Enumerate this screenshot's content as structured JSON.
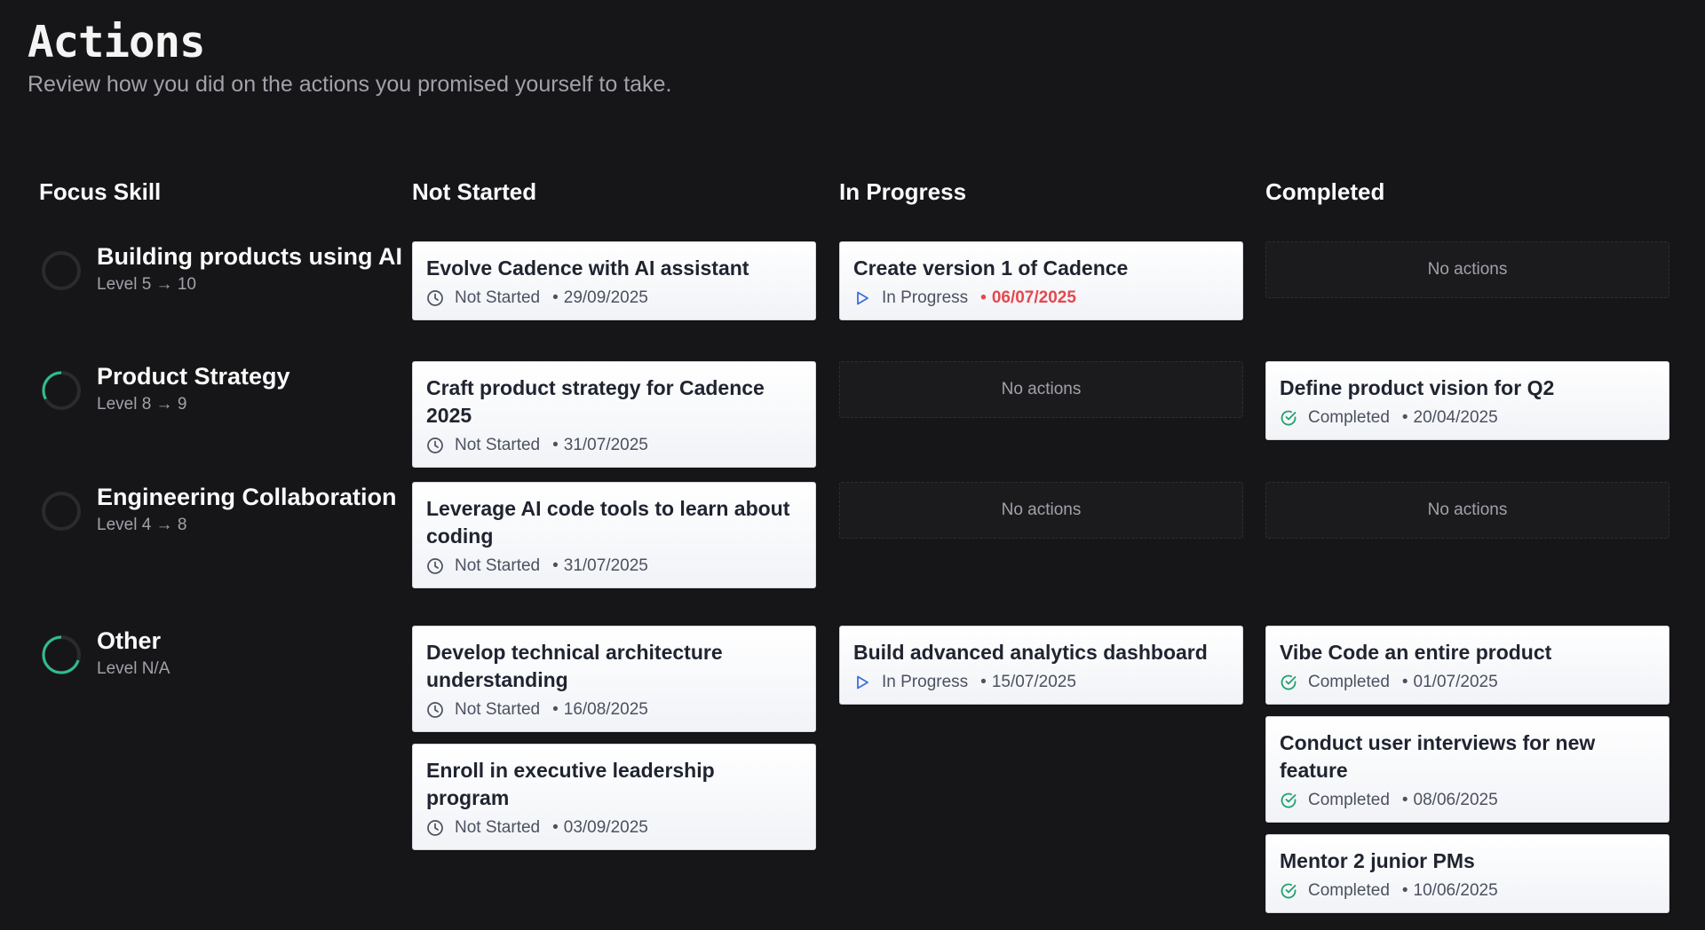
{
  "header": {
    "title": "Actions",
    "subtitle": "Review how you did on the actions you promised yourself to take."
  },
  "columns": {
    "skill": "Focus Skill",
    "not_started": "Not Started",
    "in_progress": "In Progress",
    "completed": "Completed"
  },
  "empty_label": "No actions",
  "colors": {
    "background": "#161618",
    "progress_ring": "#2fbf8a",
    "in_progress_icon": "#3b6fe0",
    "completed_icon": "#22a06b",
    "overdue": "#e5484d"
  },
  "rows": [
    {
      "skill": {
        "name": "Building products using AI",
        "level": "Level 5 → 10",
        "progress": 0.0
      },
      "not_started": [
        {
          "title": "Evolve Cadence with AI assistant",
          "status": "Not Started",
          "date": "29/09/2025",
          "icon": "clock-icon"
        }
      ],
      "in_progress": [
        {
          "title": "Create version 1 of Cadence",
          "status": "In Progress",
          "date": "06/07/2025",
          "icon": "play-icon",
          "overdue": true
        }
      ],
      "completed": []
    },
    {
      "skill": {
        "name": "Product Strategy",
        "level": "Level 8 → 9",
        "progress": 0.33
      },
      "not_started": [
        {
          "title": "Craft product strategy for Cadence 2025",
          "status": "Not Started",
          "date": "31/07/2025",
          "icon": "clock-icon"
        }
      ],
      "in_progress": [],
      "completed": [
        {
          "title": "Define product vision for Q2",
          "status": "Completed",
          "date": "20/04/2025",
          "icon": "check-circle-icon"
        }
      ]
    },
    {
      "skill": {
        "name": "Engineering Collaboration",
        "level": "Level 4 → 8",
        "progress": 0.0
      },
      "not_started": [
        {
          "title": "Leverage AI code tools to learn about coding",
          "status": "Not Started",
          "date": "31/07/2025",
          "icon": "clock-icon"
        }
      ],
      "in_progress": [],
      "completed": []
    },
    {
      "skill": {
        "name": "Other",
        "level": "Level N/A",
        "progress": 0.7
      },
      "not_started": [
        {
          "title": "Develop technical architecture understanding",
          "status": "Not Started",
          "date": "16/08/2025",
          "icon": "clock-icon"
        },
        {
          "title": "Enroll in executive leadership program",
          "status": "Not Started",
          "date": "03/09/2025",
          "icon": "clock-icon"
        }
      ],
      "in_progress": [
        {
          "title": "Build advanced analytics dashboard",
          "status": "In Progress",
          "date": "15/07/2025",
          "icon": "play-icon"
        }
      ],
      "completed": [
        {
          "title": "Vibe Code an entire product",
          "status": "Completed",
          "date": "01/07/2025",
          "icon": "check-circle-icon"
        },
        {
          "title": "Conduct user interviews for new feature",
          "status": "Completed",
          "date": "08/06/2025",
          "icon": "check-circle-icon"
        },
        {
          "title": "Mentor 2 junior PMs",
          "status": "Completed",
          "date": "10/06/2025",
          "icon": "check-circle-icon"
        }
      ]
    }
  ]
}
